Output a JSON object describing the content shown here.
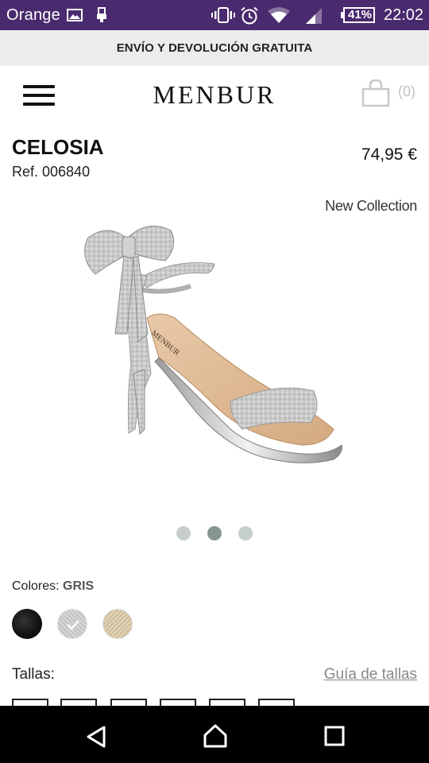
{
  "status_bar": {
    "carrier": "Orange",
    "battery": "41%",
    "time": "22:02",
    "icons": [
      "image-notification-icon",
      "usb-icon",
      "vibrate-icon",
      "alarm-icon",
      "wifi-icon",
      "signal-icon",
      "battery-icon"
    ]
  },
  "promo": {
    "text": "ENVÍO Y DEVOLUCIÓN GRATUITA"
  },
  "header": {
    "logo": "MENBUR",
    "cart_count": "(0)",
    "menu_icon": "hamburger-menu-icon",
    "cart_icon": "shopping-bag-icon"
  },
  "product": {
    "name": "CELOSIA",
    "ref": "Ref. 006840",
    "price": "74,95 €",
    "badge": "New Collection",
    "brand_on_insole": "MENBUR"
  },
  "carousel": {
    "count": 3,
    "active_index": 1
  },
  "colors": {
    "label": "Colores:",
    "selected": "GRIS",
    "options": [
      {
        "name": "black",
        "hex": "#111111"
      },
      {
        "name": "gris",
        "hex": "#cfcfcf",
        "selected": true
      },
      {
        "name": "gold",
        "hex": "#d8c7a4"
      }
    ]
  },
  "sizes": {
    "label": "Tallas:",
    "guide_link": "Guía de tallas"
  },
  "nav": {
    "icons": [
      "back-icon",
      "home-icon",
      "recent-apps-icon"
    ]
  },
  "theme": {
    "statusbar": "#4a2a6e",
    "promo_bg": "#ececec",
    "dot_active": "#84968f",
    "dot_inactive": "#c6cece"
  }
}
